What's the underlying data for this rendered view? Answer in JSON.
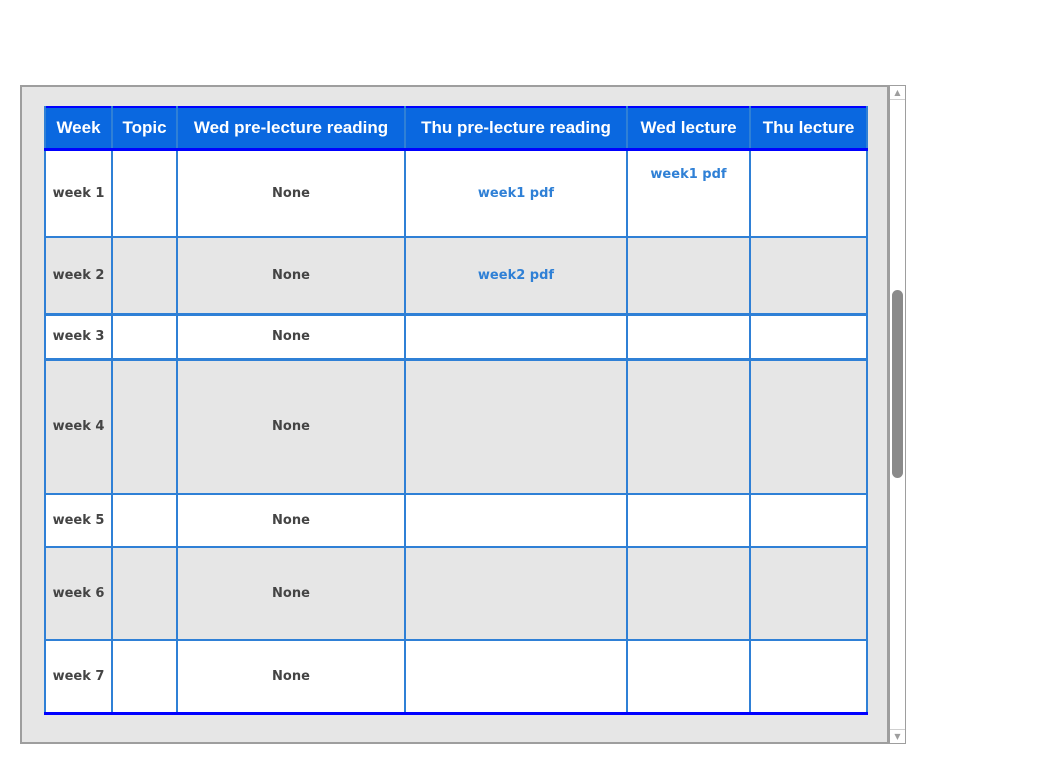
{
  "table": {
    "headers": [
      "Week",
      "Topic",
      "Wed pre-lecture reading",
      "Thu pre-lecture reading",
      "Wed lecture",
      "Thu lecture"
    ],
    "rows": [
      {
        "week": "week 1",
        "topic": "",
        "wed_reading": "None",
        "thu_reading": "week1 pdf",
        "wed_lecture": "week1 pdf",
        "thu_lecture": ""
      },
      {
        "week": "week 2",
        "topic": "",
        "wed_reading": "None",
        "thu_reading": "week2 pdf",
        "wed_lecture": "",
        "thu_lecture": ""
      },
      {
        "week": "week 3",
        "topic": "",
        "wed_reading": "None",
        "thu_reading": "",
        "wed_lecture": "",
        "thu_lecture": ""
      },
      {
        "week": "week 4",
        "topic": "",
        "wed_reading": "None",
        "thu_reading": "",
        "wed_lecture": "",
        "thu_lecture": ""
      },
      {
        "week": "week 5",
        "topic": "",
        "wed_reading": "None",
        "thu_reading": "",
        "wed_lecture": "",
        "thu_lecture": ""
      },
      {
        "week": "week 6",
        "topic": "",
        "wed_reading": "None",
        "thu_reading": "",
        "wed_lecture": "",
        "thu_lecture": ""
      },
      {
        "week": "week 7",
        "topic": "",
        "wed_reading": "None",
        "thu_reading": "",
        "wed_lecture": "",
        "thu_lecture": ""
      }
    ]
  },
  "scrollbar": {
    "up_icon": "scroll-up-arrow-icon",
    "down_icon": "scroll-down-arrow-icon"
  },
  "colors": {
    "header_bg": "#0a68e0",
    "border": "#2f80d6",
    "accent_border": "#0000ff",
    "link": "#2f80d6",
    "alt_row": "#e6e6e6"
  }
}
